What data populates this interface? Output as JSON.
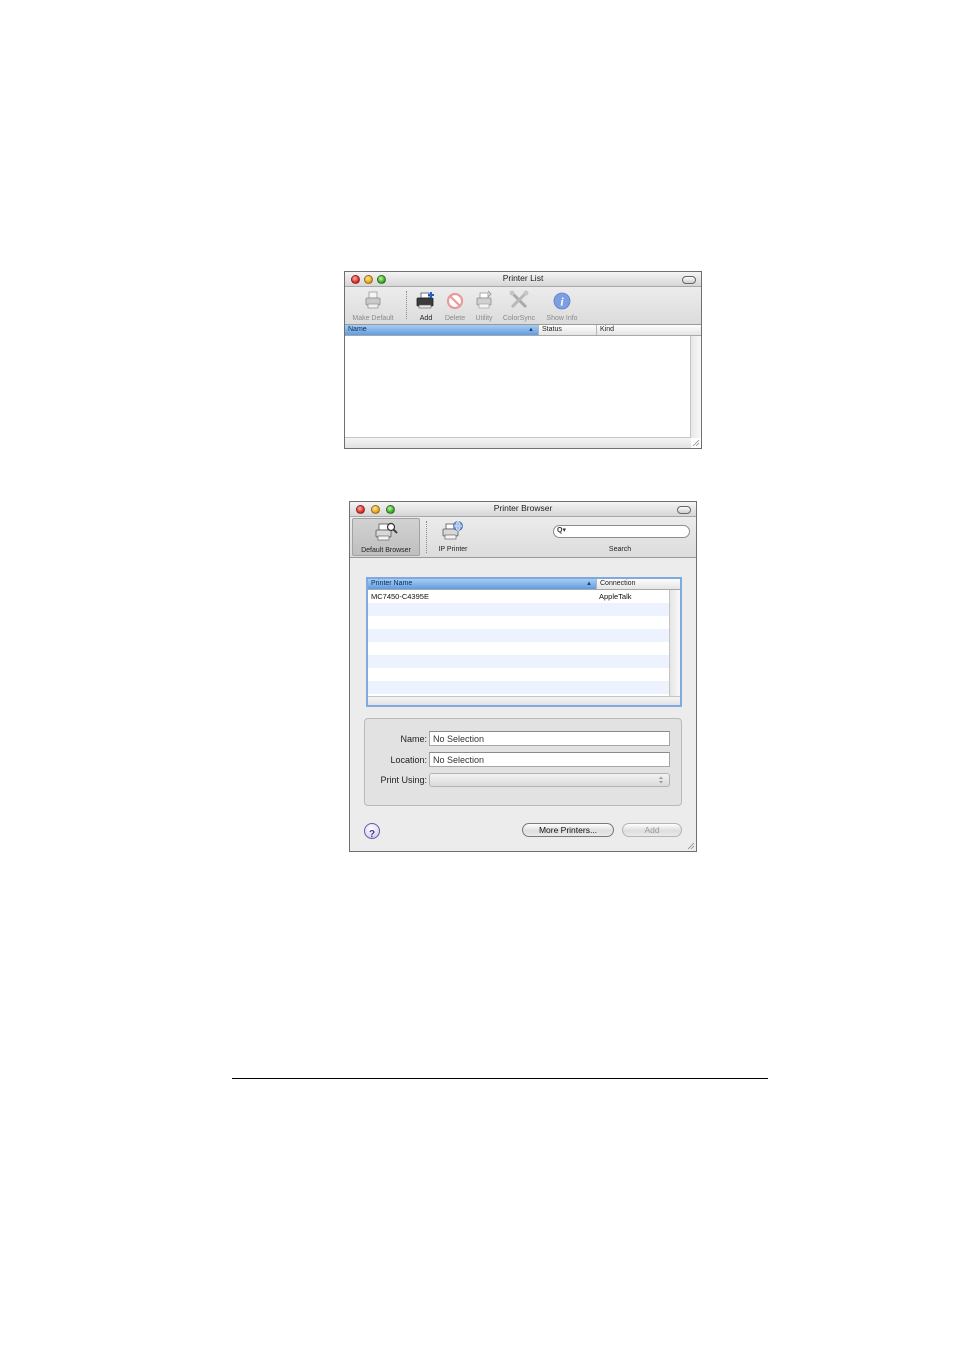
{
  "printer_list": {
    "title": "Printer List",
    "toolbar": {
      "make_default": "Make Default",
      "add": "Add",
      "delete": "Delete",
      "utility": "Utility",
      "colorsync": "ColorSync",
      "show_info": "Show Info"
    },
    "columns": {
      "name": "Name",
      "status": "Status",
      "kind": "Kind"
    },
    "sort_indicator": "▲"
  },
  "printer_browser": {
    "title": "Printer Browser",
    "toolbar": {
      "default_browser": "Default Browser",
      "ip_printer": "IP Printer",
      "search": "Search",
      "search_glyph": "Q▾"
    },
    "columns": {
      "printer_name": "Printer Name",
      "connection": "Connection"
    },
    "sort_indicator": "▲",
    "rows": [
      {
        "printer_name": "MC7450-C4395E",
        "connection": "AppleTalk"
      }
    ],
    "form": {
      "name_label": "Name:",
      "name_value": "No Selection",
      "location_label": "Location:",
      "location_value": "No Selection",
      "print_using_label": "Print Using:"
    },
    "buttons": {
      "help": "?",
      "more_printers": "More Printers...",
      "add": "Add"
    }
  },
  "colors": {
    "accent_blue": "#5f9de0",
    "stripe_blue": "#edf3fe",
    "red": "#e0302a",
    "yellow": "#e8a81c",
    "green": "#3eb02a"
  }
}
